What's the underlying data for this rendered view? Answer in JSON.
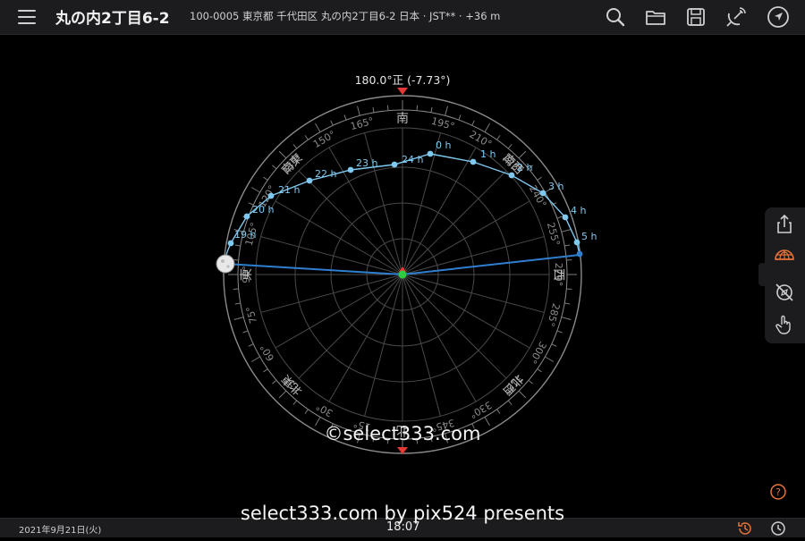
{
  "header": {
    "title": "丸の内2丁目6-2",
    "address": "100-0005 東京都 千代田区 丸の内2丁目6-2 日本 · JST** · +36 m"
  },
  "toolbar": {
    "icons": [
      "search-icon",
      "folder-icon",
      "save-icon",
      "satellite-dish-icon",
      "navigation-arrow-icon"
    ]
  },
  "compass": {
    "heading_label": "180.0°正 (-7.73°)",
    "directions": {
      "south": "南",
      "west": "西",
      "north": "北",
      "east": "東",
      "southeast": "南東",
      "southwest": "南西",
      "northeast": "北東",
      "northwest": "北西"
    },
    "degree_labels": [
      "75°",
      "90°",
      "105°",
      "120°",
      "135°",
      "150°",
      "165°",
      "195°",
      "210°",
      "225°",
      "240°",
      "255°",
      "270°",
      "285°",
      "300°",
      "315°",
      "330°",
      "345°",
      "15°",
      "30°",
      "45°",
      "60°"
    ]
  },
  "moon_path": {
    "hour_labels": [
      "19 h",
      "20 h",
      "21 h",
      "22 h",
      "23 h",
      "24 h",
      "0 h",
      "1 h",
      "2 h",
      "3 h",
      "4 h",
      "5 h"
    ],
    "color": "#7fc8f0",
    "line_color": "#2f7fd0"
  },
  "side_panel": {
    "icons": [
      "share-icon",
      "sun-dome-icon",
      "compass-off-icon",
      "hand-pointer-icon"
    ]
  },
  "footer": {
    "date": "2021年9月21日(火)",
    "time": "18:07",
    "accent": "#e8733a"
  },
  "watermarks": {
    "center": "©select333.com",
    "bottom": "select333.com by pix524 presents"
  }
}
